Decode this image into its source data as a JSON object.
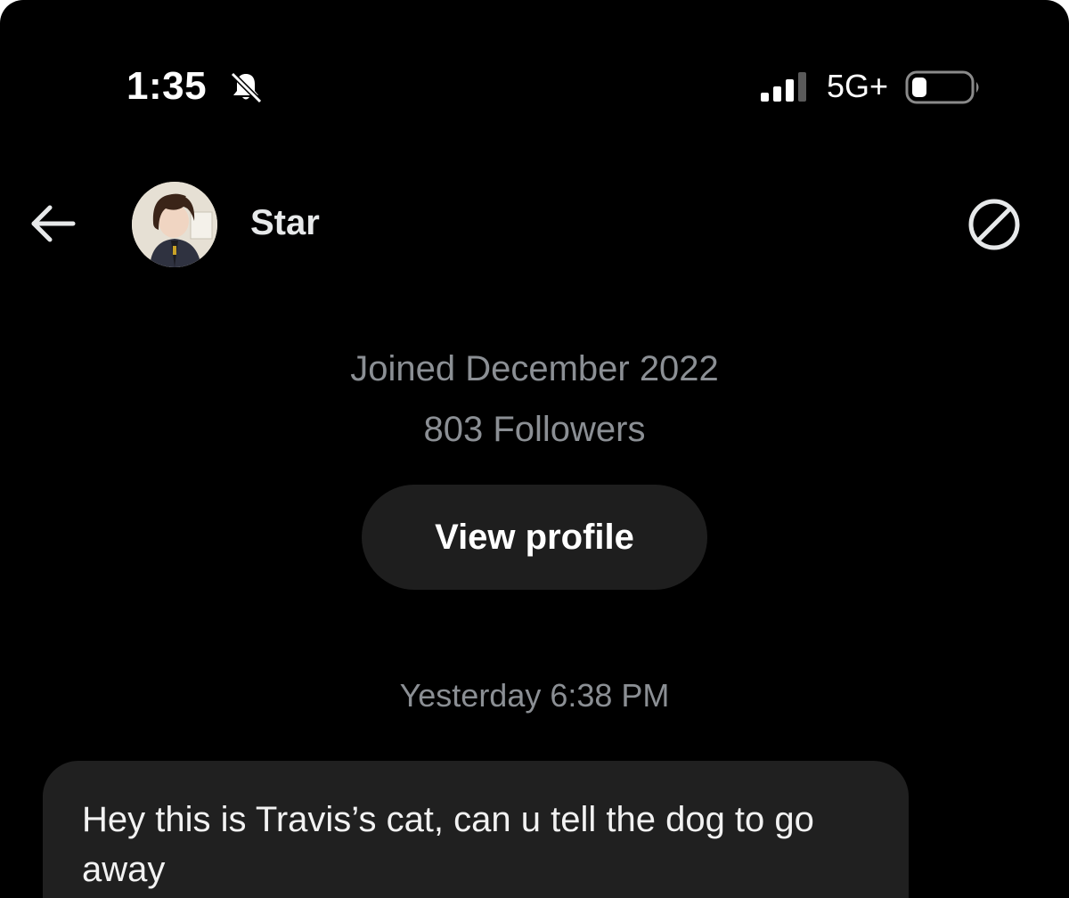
{
  "status_bar": {
    "time": "1:35",
    "network": "5G+",
    "icons": [
      "bell-slash-icon",
      "signal-icon",
      "battery-icon"
    ]
  },
  "header": {
    "contact_name": "Star",
    "back_icon": "arrow-left-icon",
    "block_icon": "block-icon"
  },
  "profile": {
    "joined": "Joined December 2022",
    "followers": "803 Followers",
    "view_profile_label": "View profile"
  },
  "conversation": {
    "timestamp": "Yesterday 6:38 PM",
    "messages": [
      {
        "text": "Hey this is Travis’s cat, can u tell the dog to go away"
      }
    ]
  },
  "colors": {
    "background": "#000000",
    "secondary_text": "#8b8f94",
    "button_bg": "#1e1e1e",
    "bubble_bg": "#202020"
  }
}
